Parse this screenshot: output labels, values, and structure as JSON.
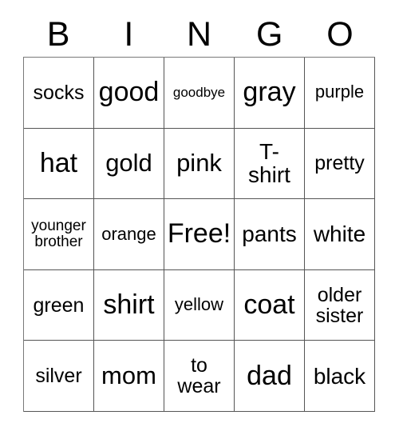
{
  "card": {
    "type": "bingo-card",
    "header": {
      "letters": [
        "B",
        "I",
        "N",
        "G",
        "O"
      ]
    },
    "grid": {
      "columns": 5,
      "rows": 5,
      "free_space": {
        "row": 3,
        "column": 3,
        "label": "Free!"
      },
      "cells": [
        {
          "text": "socks",
          "size": "fs-m"
        },
        {
          "text": "good",
          "size": "fs-xxl"
        },
        {
          "text": "goodbye",
          "size": "fs-xxs"
        },
        {
          "text": "gray",
          "size": "fs-xxl"
        },
        {
          "text": "purple",
          "size": "fs-s"
        },
        {
          "text": "hat",
          "size": "fs-xxl"
        },
        {
          "text": "gold",
          "size": "fs-xl"
        },
        {
          "text": "pink",
          "size": "fs-xl"
        },
        {
          "text": "T-\nshirt",
          "size": "fs-l"
        },
        {
          "text": "pretty",
          "size": "fs-m"
        },
        {
          "text": "younger\nbrother",
          "size": "fs-xs"
        },
        {
          "text": "orange",
          "size": "fs-s"
        },
        {
          "text": "Free!",
          "size": "fs-xxl"
        },
        {
          "text": "pants",
          "size": "fs-l"
        },
        {
          "text": "white",
          "size": "fs-l"
        },
        {
          "text": "green",
          "size": "fs-m"
        },
        {
          "text": "shirt",
          "size": "fs-xxl"
        },
        {
          "text": "yellow",
          "size": "fs-s"
        },
        {
          "text": "coat",
          "size": "fs-xxl"
        },
        {
          "text": "older\nsister",
          "size": "fs-m"
        },
        {
          "text": "silver",
          "size": "fs-m"
        },
        {
          "text": "mom",
          "size": "fs-xl"
        },
        {
          "text": "to\nwear",
          "size": "fs-m"
        },
        {
          "text": "dad",
          "size": "fs-xxl"
        },
        {
          "text": "black",
          "size": "fs-l"
        }
      ]
    },
    "colors": {
      "background": "#ffffff",
      "text": "#000000",
      "border": "#555555"
    }
  }
}
